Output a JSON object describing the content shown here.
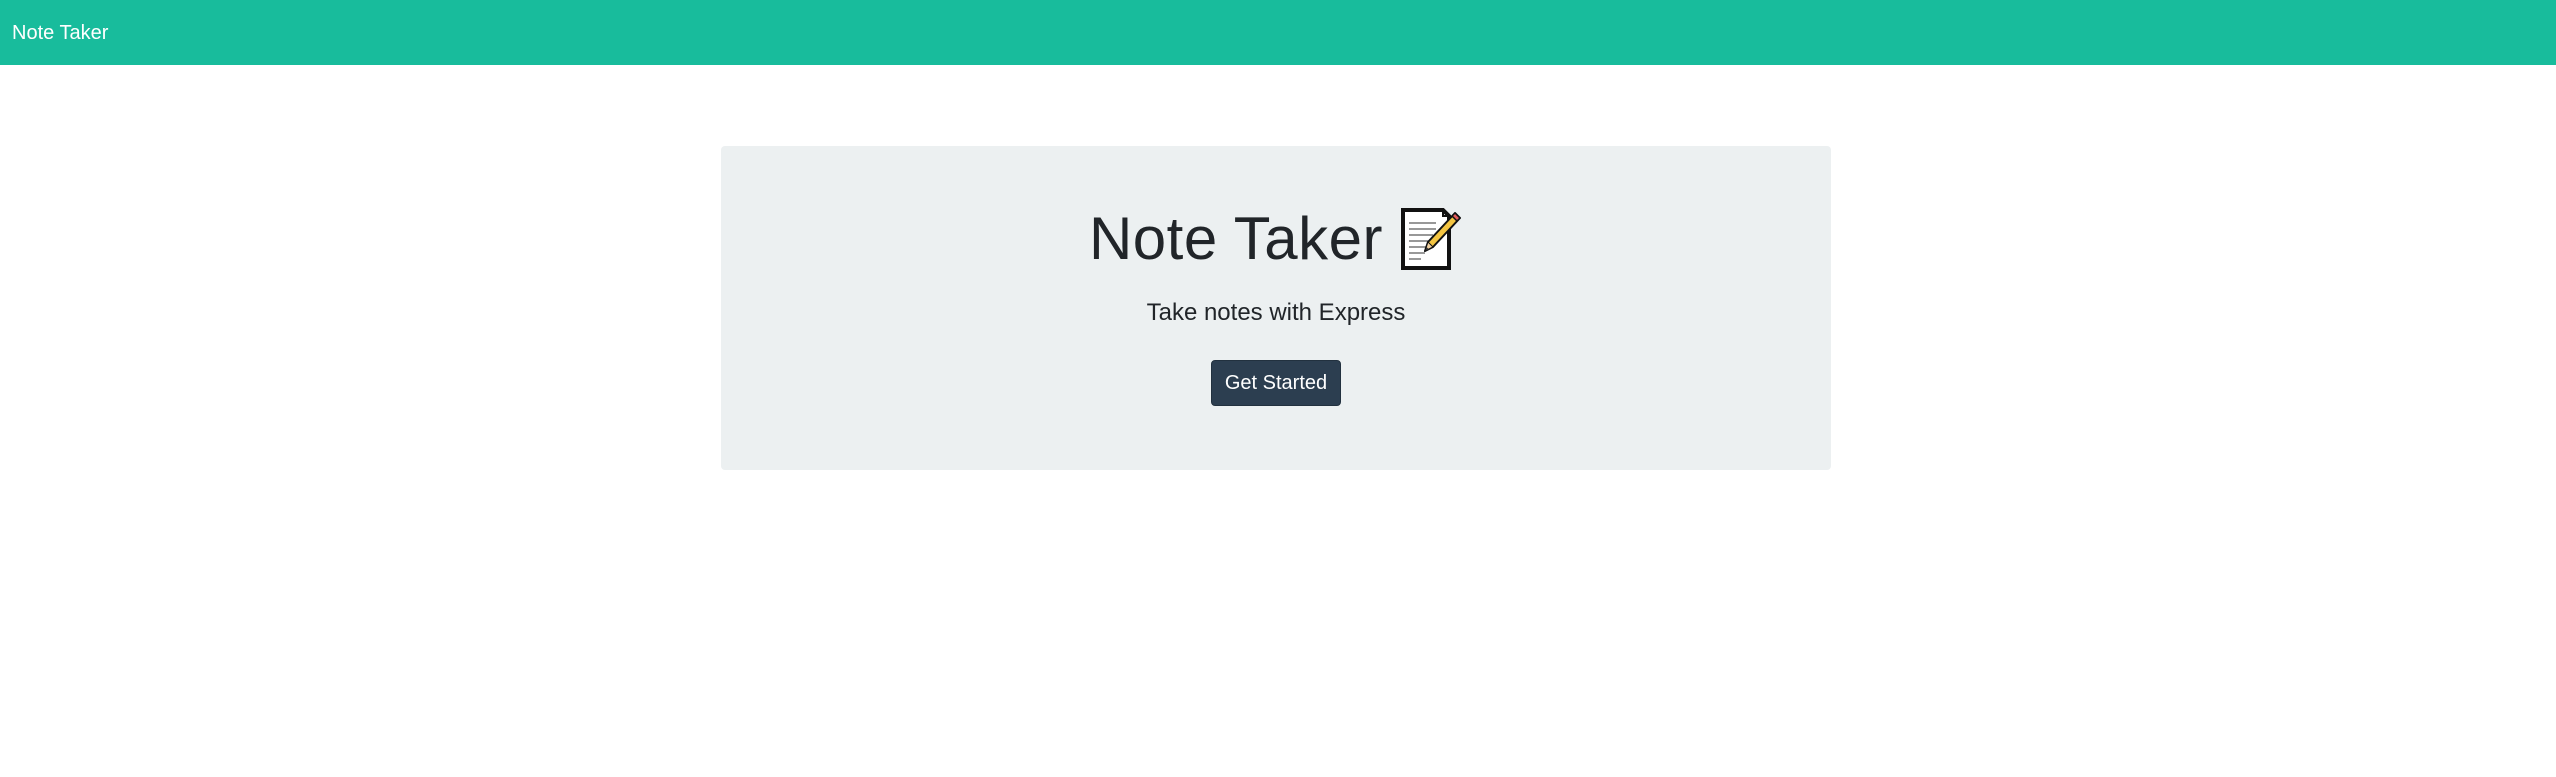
{
  "navbar": {
    "brand": "Note Taker",
    "background": "#18bc9c"
  },
  "hero": {
    "title": "Note Taker",
    "icon": "memo-icon",
    "subtitle": "Take notes with Express",
    "cta_label": "Get Started",
    "background": "#ecf0f1",
    "button_color": "#2c3e50"
  }
}
